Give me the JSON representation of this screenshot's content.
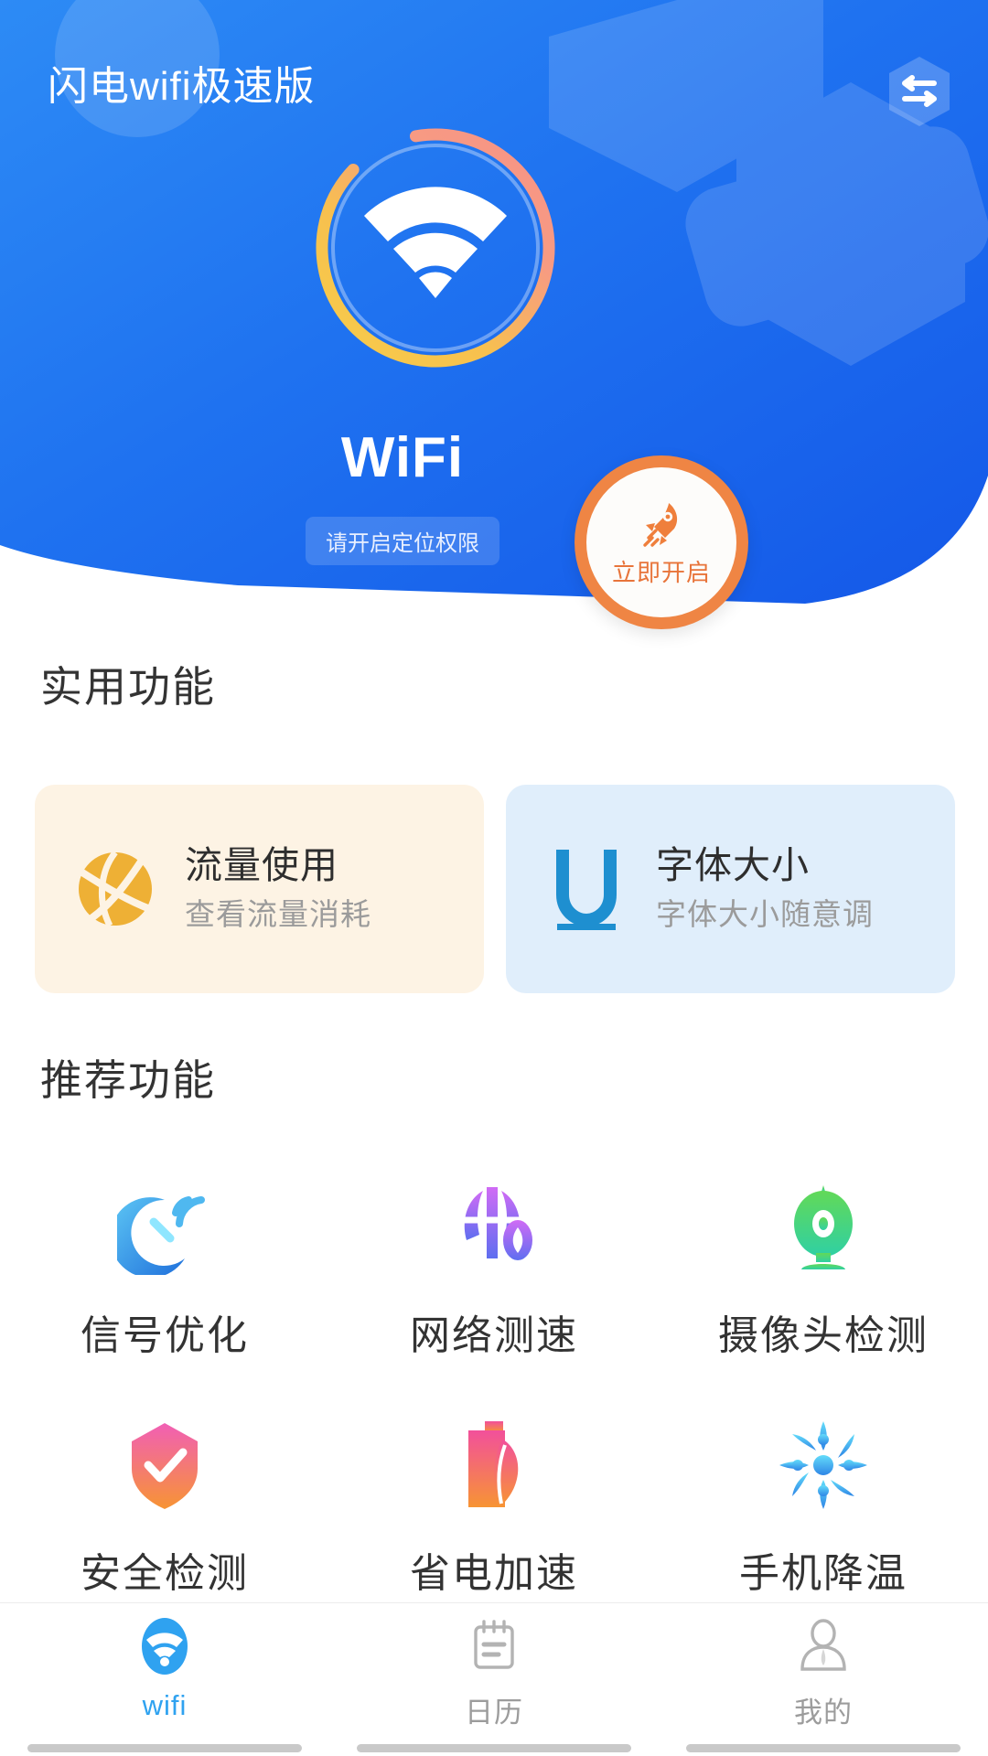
{
  "header": {
    "app_title": "闪电wifi极速版",
    "swap_icon": "swap-arrows-icon",
    "wifi_status_label": "WiFi",
    "permission_badge": "请开启定位权限",
    "brand_blue": "#1565ef",
    "ring_start_color": "#f5c443",
    "ring_end_color": "#f79a86"
  },
  "cta": {
    "label": "立即开启",
    "icon": "rocket-icon",
    "accent_color": "#ef8544"
  },
  "utility": {
    "section_title": "实用功能",
    "cards": [
      {
        "title": "流量使用",
        "subtitle": "查看流量消耗",
        "icon": "data-globe-icon",
        "bg": "#fdf3e4",
        "icon_color": "#eeb035"
      },
      {
        "title": "字体大小",
        "subtitle": "字体大小随意调",
        "icon": "font-size-u-icon",
        "bg": "#e0eefb",
        "icon_color": "#1e8fd0"
      }
    ]
  },
  "recommended": {
    "section_title": "推荐功能",
    "items": [
      {
        "label": "信号优化",
        "icon": "satellite-signal-icon",
        "color": "#2f7de1"
      },
      {
        "label": "网络测速",
        "icon": "speed-test-icon",
        "color": "#a355ef"
      },
      {
        "label": "摄像头检测",
        "icon": "camera-detect-icon",
        "color": "#35c06a"
      },
      {
        "label": "安全检测",
        "icon": "shield-check-icon",
        "color": "#f2629c"
      },
      {
        "label": "省电加速",
        "icon": "battery-boost-icon",
        "color": "#f2509b"
      },
      {
        "label": "手机降温",
        "icon": "snowflake-cool-icon",
        "color": "#35a8ee"
      }
    ]
  },
  "bottom_nav": {
    "items": [
      {
        "label": "wifi",
        "icon": "wifi-icon",
        "active": true
      },
      {
        "label": "日历",
        "icon": "calendar-icon",
        "active": false
      },
      {
        "label": "我的",
        "icon": "person-icon",
        "active": false
      }
    ],
    "active_color": "#2fa2f0",
    "inactive_color": "#9c9c9c"
  }
}
